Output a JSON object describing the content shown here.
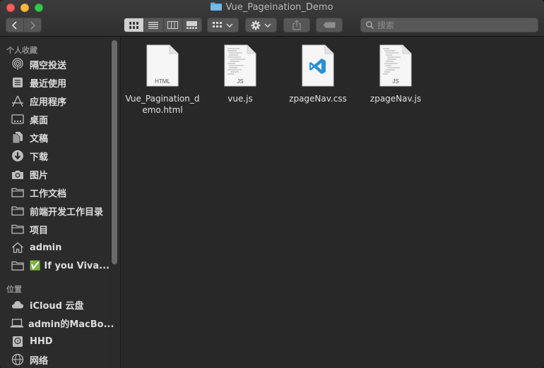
{
  "window": {
    "title": "Vue_Pageination_Demo"
  },
  "toolbar": {
    "back_icon": "chevron-left-icon",
    "forward_icon": "chevron-right-icon",
    "view_modes": [
      "icon-view",
      "list-view",
      "column-view",
      "gallery-view"
    ],
    "search_placeholder": "搜索"
  },
  "sidebar": {
    "favorites_title": "个人收藏",
    "favorites": [
      {
        "label": "隔空投送",
        "icon": "airdrop-icon"
      },
      {
        "label": "最近使用",
        "icon": "recents-icon"
      },
      {
        "label": "应用程序",
        "icon": "applications-icon"
      },
      {
        "label": "桌面",
        "icon": "desktop-icon"
      },
      {
        "label": "文稿",
        "icon": "documents-icon"
      },
      {
        "label": "下载",
        "icon": "downloads-icon"
      },
      {
        "label": "图片",
        "icon": "pictures-icon"
      },
      {
        "label": "工作文档",
        "icon": "folder-icon"
      },
      {
        "label": "前端开发工作目录",
        "icon": "folder-icon"
      },
      {
        "label": "项目",
        "icon": "folder-icon"
      },
      {
        "label": "admin",
        "icon": "home-icon"
      },
      {
        "label": "✅ If you Viva...",
        "icon": "folder-icon"
      }
    ],
    "locations_title": "位置",
    "locations": [
      {
        "label": "iCloud 云盘",
        "icon": "icloud-icon"
      },
      {
        "label": "admin的MacBo...",
        "icon": "laptop-icon"
      },
      {
        "label": "HHD",
        "icon": "disk-icon"
      },
      {
        "label": "网络",
        "icon": "network-icon"
      }
    ]
  },
  "files": [
    {
      "name": "Vue_Pagination_demo.html",
      "badge": "HTML",
      "icon": "html-file-icon"
    },
    {
      "name": "vue.js",
      "badge": "JS",
      "icon": "js-file-icon"
    },
    {
      "name": "zpageNav.css",
      "badge": "",
      "icon": "vscode-file-icon"
    },
    {
      "name": "zpageNav.js",
      "badge": "JS",
      "icon": "js-file-icon"
    }
  ]
}
